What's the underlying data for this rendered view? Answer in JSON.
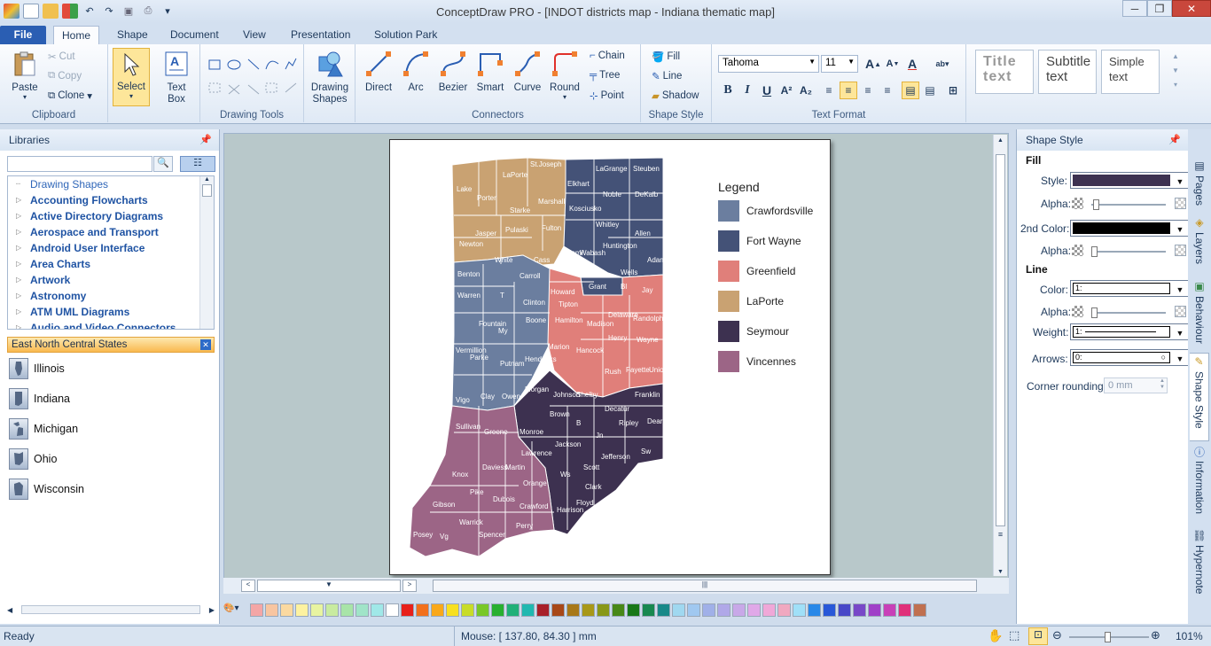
{
  "window": {
    "title": "ConceptDraw PRO - [INDOT districts map - Indiana thematic map]"
  },
  "tabs": [
    "File",
    "Home",
    "Shape",
    "Document",
    "View",
    "Presentation",
    "Solution Park"
  ],
  "ribbon": {
    "clipboard": {
      "label": "Clipboard",
      "paste": "Paste",
      "cut": "Cut",
      "copy": "Copy",
      "clone": "Clone"
    },
    "select": {
      "label": "Select"
    },
    "textbox": {
      "label": "Text Box"
    },
    "drawing_tools": {
      "label": "Drawing Tools"
    },
    "drawing_shapes": {
      "label": "Drawing Shapes"
    },
    "connectors": {
      "label": "Connectors",
      "direct": "Direct",
      "arc": "Arc",
      "bezier": "Bezier",
      "smart": "Smart",
      "curve": "Curve",
      "round": "Round",
      "chain": "Chain",
      "tree": "Tree",
      "point": "Point"
    },
    "shape_style": {
      "label": "Shape Style",
      "fill": "Fill",
      "line": "Line",
      "shadow": "Shadow"
    },
    "text_format": {
      "label": "Text Format",
      "font": "Tahoma",
      "size": "11"
    },
    "styles": {
      "title": "Title text",
      "subtitle": "Subtitle text",
      "simple": "Simple text"
    }
  },
  "libraries": {
    "title": "Libraries",
    "items": [
      "Drawing Shapes",
      "Accounting Flowcharts",
      "Active Directory Diagrams",
      "Aerospace and Transport",
      "Android User Interface",
      "Area Charts",
      "Artwork",
      "Astronomy",
      "ATM UML Diagrams",
      "Audio and Video Connectors"
    ],
    "section": "East North Central States",
    "states": [
      "Illinois",
      "Indiana",
      "Michigan",
      "Ohio",
      "Wisconsin"
    ]
  },
  "map": {
    "legend_title": "Legend",
    "legend": [
      {
        "name": "Crawfordsville",
        "color": "#6b7e9f"
      },
      {
        "name": "Fort Wayne",
        "color": "#445277"
      },
      {
        "name": "Greenfield",
        "color": "#e07f7a"
      },
      {
        "name": "LaPorte",
        "color": "#c9a272"
      },
      {
        "name": "Seymour",
        "color": "#3d3150"
      },
      {
        "name": "Vincennes",
        "color": "#9c6586"
      }
    ],
    "counties": {
      "laporte": [
        "Lake",
        "Porter",
        "LaPorte",
        "St.Joseph",
        "Newton",
        "Jasper",
        "Starke",
        "Marshall",
        "Pulaski",
        "Fulton",
        "White",
        "Cass",
        "Carroll"
      ],
      "fortwayne": [
        "Elkhart",
        "LaGrange",
        "Steuben",
        "Noble",
        "DeKalb",
        "Kosciusko",
        "Whitley",
        "Allen",
        "Miami",
        "Wabash",
        "Huntington",
        "Wells",
        "Adams",
        "Grant",
        "Bl"
      ],
      "crawfordsville": [
        "Benton",
        "Warren",
        "Fountain",
        "T",
        "Clinton",
        "Boone",
        "My",
        "Vermillion",
        "Parke",
        "Putnam",
        "Hendricks",
        "Vigo",
        "Clay",
        "Owen"
      ],
      "greenfield": [
        "Howard",
        "Tipton",
        "Hamilton",
        "Madison",
        "Delaware",
        "Jay",
        "Randolph",
        "Marion",
        "Hancock",
        "Henry",
        "Wayne",
        "Shelby",
        "Rush",
        "Fayette",
        "Union"
      ],
      "seymour": [
        "Johnson",
        "Morgan",
        "Brown",
        "B",
        "Decatur",
        "Franklin",
        "Monroe",
        "Jackson",
        "Jn",
        "Ripley",
        "Dearborn",
        "Jefferson",
        "Sw",
        "Scott",
        "Ws",
        "Clark",
        "Harrison",
        "Floyd"
      ],
      "vincennes": [
        "Sullivan",
        "Greene",
        "Knox",
        "Daviess",
        "Martin",
        "Lawrence",
        "Orange",
        "Gibson",
        "Pike",
        "Dubois",
        "Crawford",
        "Posey",
        "Vg",
        "Warrick",
        "Spencer",
        "Perry"
      ]
    }
  },
  "shape_style_panel": {
    "title": "Shape Style",
    "fill": "Fill",
    "style": "Style:",
    "alpha": "Alpha:",
    "second_color": "2nd Color:",
    "line": "Line",
    "color": "Color:",
    "weight": "Weight:",
    "arrows": "Arrows:",
    "corner_rounding": "Corner rounding:",
    "corner_value": "0 mm",
    "line_color_value": "1:",
    "weight_value": "1:",
    "arrows_value": "0:",
    "fill_color": "#3d3150",
    "second_color_value": "#000000"
  },
  "side_tabs": [
    "Pages",
    "Layers",
    "Behaviour",
    "Shape Style",
    "Information",
    "Hypernote"
  ],
  "status": {
    "ready": "Ready",
    "mouse": "Mouse: [ 137.80, 84.30 ] mm",
    "zoom": "101%"
  },
  "palette": [
    "#f4a6a6",
    "#f8c5a0",
    "#fbd9a0",
    "#fdf2a0",
    "#e8f4a0",
    "#c8eba0",
    "#a8e4a8",
    "#a0e4c8",
    "#a0e8e8",
    "#ffffff",
    "#e8201a",
    "#f2701c",
    "#f9a81a",
    "#f8e020",
    "#c8dc28",
    "#78c828",
    "#28b030",
    "#20b078",
    "#20b8b0",
    "#a8202a",
    "#a84818",
    "#a87818",
    "#a89818",
    "#889818",
    "#488818",
    "#187818",
    "#188850",
    "#188888",
    "#a0d8f0",
    "#a0c8f0",
    "#a0b0e8",
    "#b0a8e8",
    "#c8a8e8",
    "#e0a8e8",
    "#f0a8d8",
    "#f0a8c0",
    "#a0e0f8",
    "#2888e8",
    "#2858d8",
    "#4848c8",
    "#7848c8",
    "#a040c8",
    "#c840b8",
    "#e0307a",
    "#c07050"
  ]
}
